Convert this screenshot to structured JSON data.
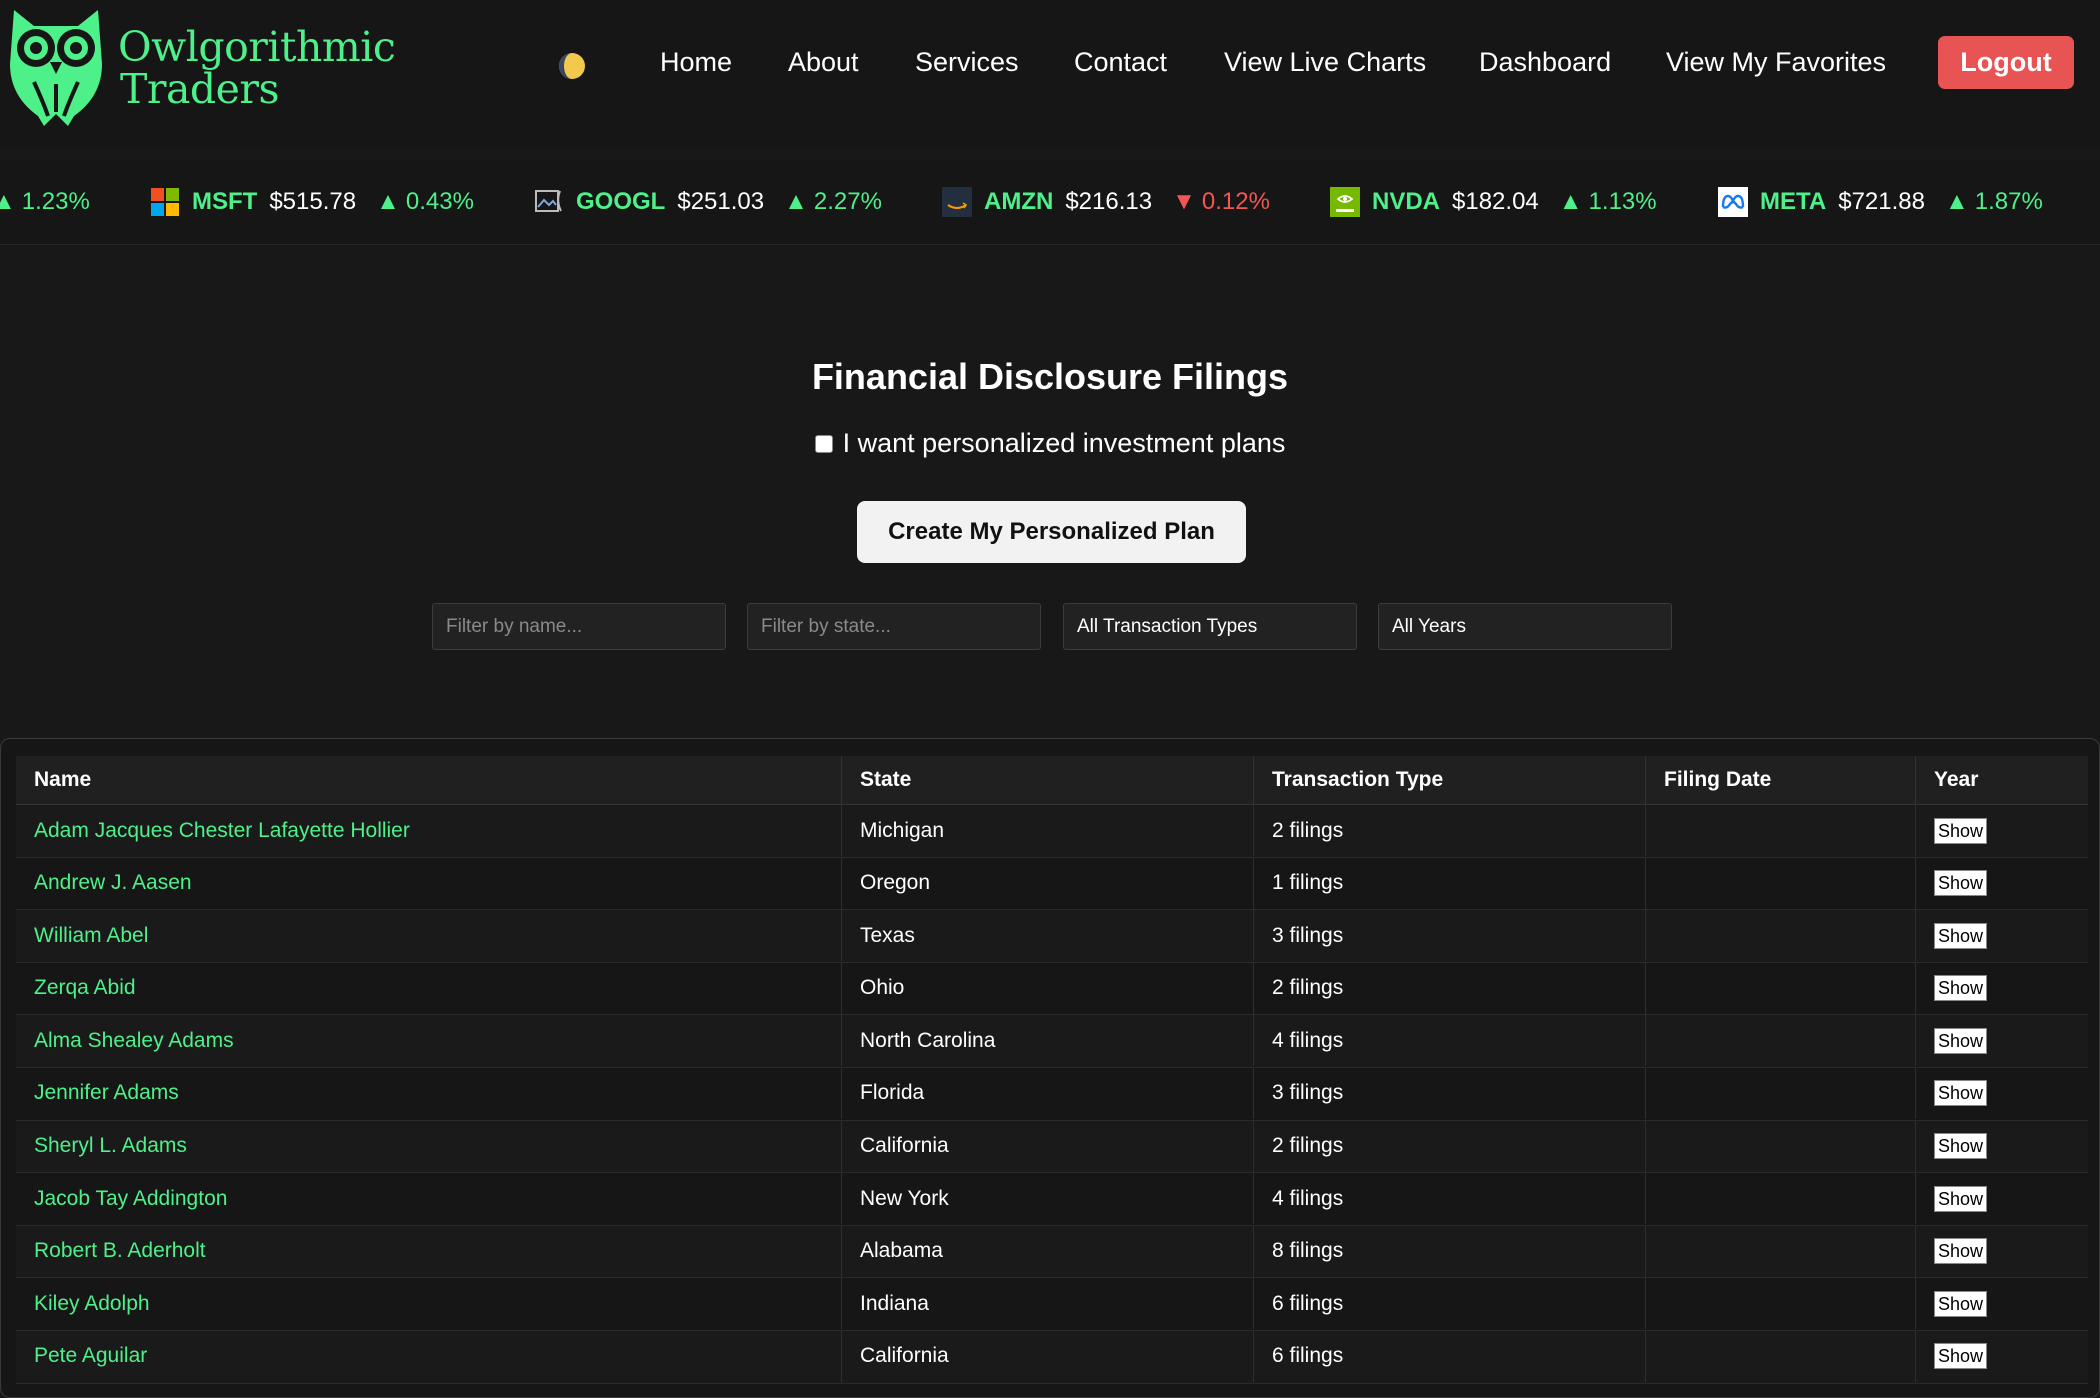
{
  "brand": {
    "line1": "Owlgorithmic",
    "line2": "Traders",
    "accent_color": "#4ef08a"
  },
  "theme_toggle": {
    "icon": "moon-icon"
  },
  "nav": {
    "items": [
      {
        "label": "Home"
      },
      {
        "label": "About"
      },
      {
        "label": "Services"
      },
      {
        "label": "Contact"
      },
      {
        "label": "View Live Charts"
      },
      {
        "label": "Dashboard"
      },
      {
        "label": "View My Favorites"
      }
    ],
    "logout_label": "Logout",
    "logout_color": "#e85454"
  },
  "ticker": {
    "partial_change": "1.23%",
    "items": [
      {
        "symbol": "MSFT",
        "price": "$515.78",
        "direction": "up",
        "change": "0.43%",
        "icon": "microsoft-logo-icon"
      },
      {
        "symbol": "GOOGL",
        "price": "$251.03",
        "direction": "up",
        "change": "2.27%",
        "icon": "broken-image-icon"
      },
      {
        "symbol": "AMZN",
        "price": "$216.13",
        "direction": "down",
        "change": "0.12%",
        "icon": "amazon-logo-icon"
      },
      {
        "symbol": "NVDA",
        "price": "$182.04",
        "direction": "up",
        "change": "1.13%",
        "icon": "nvidia-logo-icon"
      },
      {
        "symbol": "META",
        "price": "$721.88",
        "direction": "up",
        "change": "1.87%",
        "icon": "meta-logo-icon"
      }
    ],
    "up_color": "#4ef08a",
    "down_color": "#f25555"
  },
  "main": {
    "title": "Financial Disclosure Filings",
    "checkbox_label": "I want personalized investment plans",
    "create_button": "Create My Personalized Plan",
    "filters": {
      "name_placeholder": "Filter by name...",
      "state_placeholder": "Filter by state...",
      "type_selected": "All Transaction Types",
      "year_selected": "All Years"
    }
  },
  "table": {
    "columns": [
      "Name",
      "State",
      "Transaction Type",
      "Filing Date",
      "Year"
    ],
    "show_label": "Show",
    "rows": [
      {
        "name": "Adam Jacques Chester Lafayette Hollier",
        "state": "Michigan",
        "filings": "2 filings"
      },
      {
        "name": "Andrew J. Aasen",
        "state": "Oregon",
        "filings": "1 filings"
      },
      {
        "name": "William Abel",
        "state": "Texas",
        "filings": "3 filings"
      },
      {
        "name": "Zerqa Abid",
        "state": "Ohio",
        "filings": "2 filings"
      },
      {
        "name": "Alma Shealey Adams",
        "state": "North Carolina",
        "filings": "4 filings"
      },
      {
        "name": "Jennifer Adams",
        "state": "Florida",
        "filings": "3 filings"
      },
      {
        "name": "Sheryl L. Adams",
        "state": "California",
        "filings": "2 filings"
      },
      {
        "name": "Jacob Tay Addington",
        "state": "New York",
        "filings": "4 filings"
      },
      {
        "name": "Robert B. Aderholt",
        "state": "Alabama",
        "filings": "8 filings"
      },
      {
        "name": "Kiley Adolph",
        "state": "Indiana",
        "filings": "6 filings"
      },
      {
        "name": "Pete Aguilar",
        "state": "California",
        "filings": "6 filings"
      }
    ]
  }
}
